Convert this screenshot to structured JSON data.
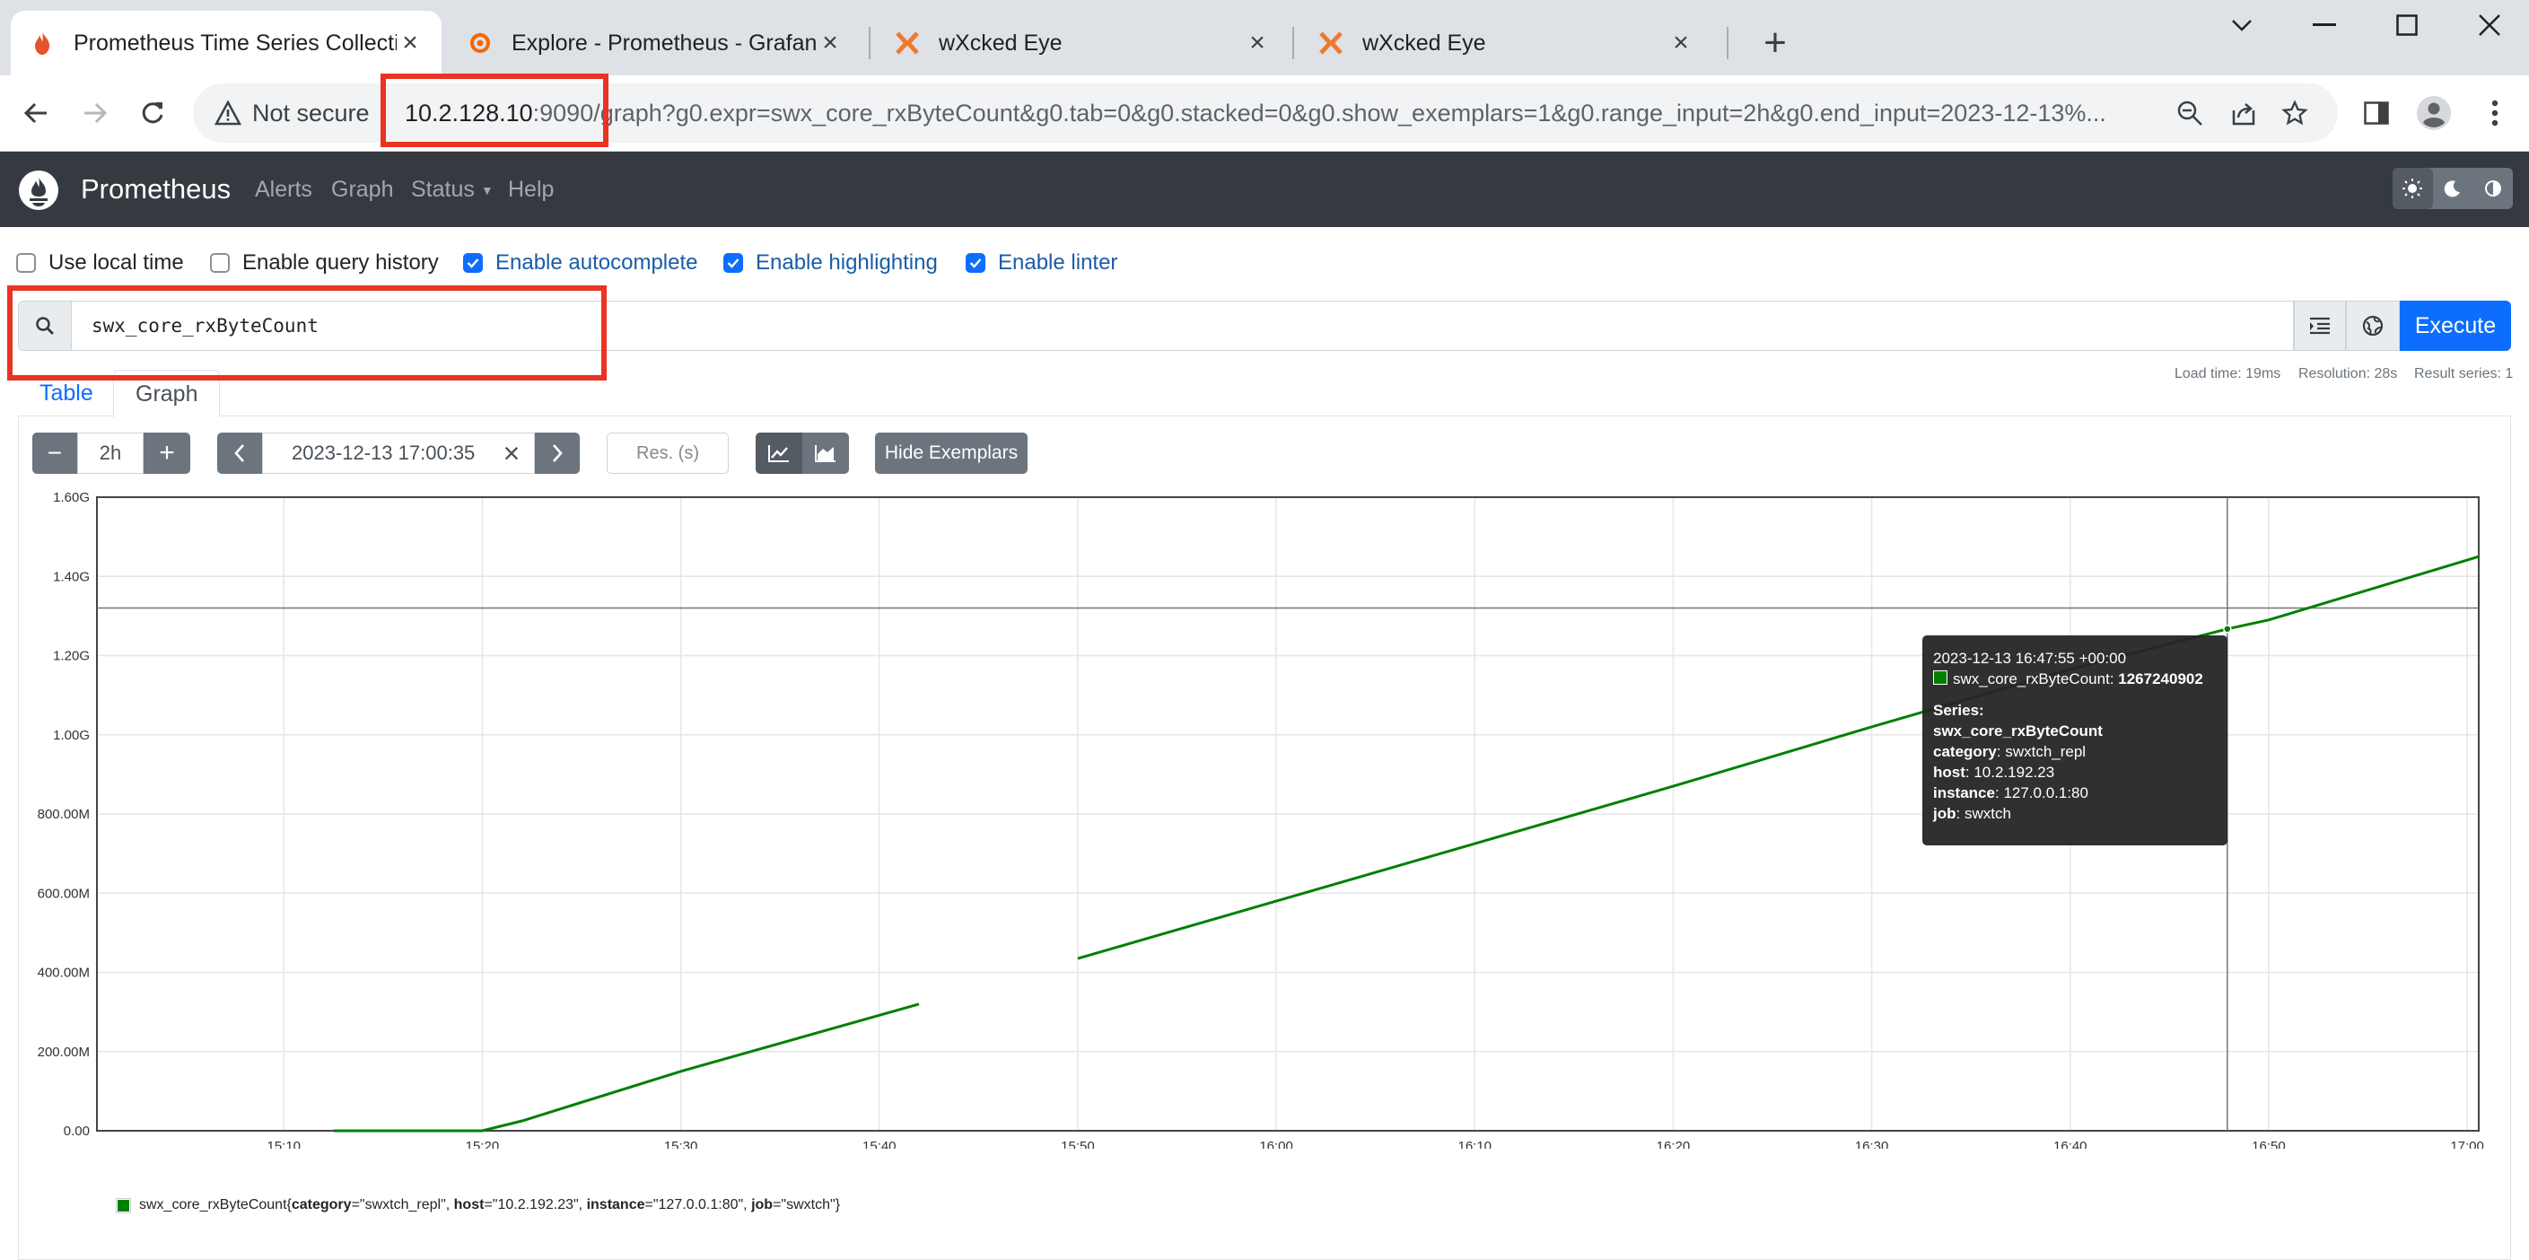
{
  "browser": {
    "tabs": [
      {
        "title": "Prometheus Time Series Collection and Processing Server",
        "icon": "prometheus-flame-icon",
        "active": true
      },
      {
        "title": "Explore - Prometheus - Grafana",
        "icon": "grafana-icon",
        "active": false
      },
      {
        "title": "wXcked Eye",
        "icon": "wxcked-eye-icon",
        "active": false
      },
      {
        "title": "wXcked Eye",
        "icon": "wxcked-eye-icon",
        "active": false
      }
    ],
    "security_label": "Not secure",
    "url_host": "10.2.128.10",
    "url_rest": ":9090/graph?g0.expr=swx_core_rxByteCount&g0.tab=0&g0.stacked=0&g0.show_exemplars=1&g0.range_input=2h&g0.end_input=2023-12-13%..."
  },
  "navbar": {
    "brand": "Prometheus",
    "links": [
      "Alerts",
      "Graph",
      "Status",
      "Help"
    ]
  },
  "options": [
    {
      "label": "Use local time",
      "checked": false
    },
    {
      "label": "Enable query history",
      "checked": false
    },
    {
      "label": "Enable autocomplete",
      "checked": true
    },
    {
      "label": "Enable highlighting",
      "checked": true
    },
    {
      "label": "Enable linter",
      "checked": true
    }
  ],
  "query": {
    "expression": "swx_core_rxByteCount",
    "execute_label": "Execute"
  },
  "stats": {
    "load_time": "Load time: 19ms",
    "resolution": "Resolution: 28s",
    "result_series": "Result series: 1"
  },
  "tabs": {
    "table": "Table",
    "graph": "Graph"
  },
  "controls": {
    "minus": "−",
    "range": "2h",
    "plus": "+",
    "end_time": "2023-12-13 17:00:35",
    "clear": "×",
    "resolution_placeholder": "Res. (s)",
    "hide_exemplars": "Hide Exemplars"
  },
  "tooltip": {
    "time": "2023-12-13 16:47:55 +00:00",
    "metric": "swx_core_rxByteCount",
    "value": "1267240902",
    "series_label": "Series:",
    "series_name": "swx_core_rxByteCount",
    "labels": [
      {
        "key": "category",
        "value": "swxtch_repl"
      },
      {
        "key": "host",
        "value": "10.2.192.23"
      },
      {
        "key": "instance",
        "value": "127.0.0.1:80"
      },
      {
        "key": "job",
        "value": "swxtch"
      }
    ]
  },
  "legend": {
    "metric": "swx_core_rxByteCount",
    "labels": [
      {
        "key": "category",
        "value": "swxtch_repl"
      },
      {
        "key": "host",
        "value": "10.2.192.23"
      },
      {
        "key": "instance",
        "value": "127.0.0.1:80"
      },
      {
        "key": "job",
        "value": "swxtch"
      }
    ]
  },
  "chart_data": {
    "type": "line",
    "title": "",
    "xlabel": "",
    "ylabel": "",
    "y_ticks": [
      "0.00",
      "200.00M",
      "400.00M",
      "600.00M",
      "800.00M",
      "1.00G",
      "1.20G",
      "1.40G",
      "1.60G"
    ],
    "x_ticks": [
      "15:10",
      "15:20",
      "15:30",
      "15:40",
      "15:50",
      "16:00",
      "16:10",
      "16:20",
      "16:30",
      "16:40",
      "16:50",
      "17:00"
    ],
    "x_range": [
      "15:00:35",
      "17:00:35"
    ],
    "ylim": [
      0,
      1600000000
    ],
    "grid": true,
    "series": [
      {
        "name": "swx_core_rxByteCount{category=\"swxtch_repl\", host=\"10.2.192.23\", instance=\"127.0.0.1:80\", job=\"swxtch\"}",
        "color": "#008000",
        "x": [
          "15:12:30",
          "15:20:00",
          "15:22:00",
          "15:30:00",
          "15:42:00",
          "15:43:30",
          "15:50:00",
          "16:00:00",
          "16:10:00",
          "16:20:00",
          "16:30:00",
          "16:40:00",
          "16:47:55",
          "16:50:00",
          "17:00:35"
        ],
        "y": [
          0,
          0,
          25000000,
          150000000,
          320000000,
          null,
          435000000,
          580000000,
          725000000,
          870000000,
          1020000000,
          1165000000,
          1267240902,
          1290000000,
          1450000000
        ]
      }
    ],
    "hover_time": "16:47:55",
    "hover_y_level": 1320000000
  }
}
